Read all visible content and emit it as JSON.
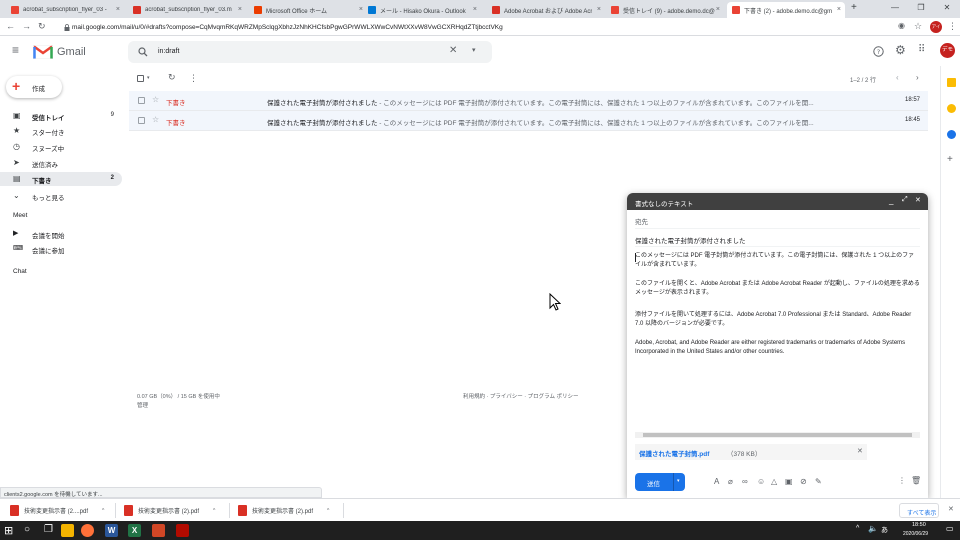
{
  "browser": {
    "tabs": [
      {
        "label": "acrobat_subscription_flyer_03 - ",
        "icon": "gmail-icon",
        "color": "#ea4335"
      },
      {
        "label": "acrobat_subscription_flyer_03.m",
        "icon": "acrobat-icon",
        "color": "#d93025"
      },
      {
        "label": "Microsoft Office ホーム",
        "icon": "office-icon",
        "color": "#eb3c00"
      },
      {
        "label": "メール - Hisako Okura - Outlook",
        "icon": "outlook-icon",
        "color": "#0078d4"
      },
      {
        "label": "Adobe Acrobat および Adobe Acr",
        "icon": "adobe-icon",
        "color": "#d93025"
      },
      {
        "label": "受信トレイ (9) - adobe.demo.dc@",
        "icon": "gmail-icon",
        "color": "#ea4335"
      },
      {
        "label": "下書き (2) - adobe.demo.dc@gm",
        "icon": "gmail-icon",
        "color": "#ea4335"
      }
    ],
    "new_tab": "+",
    "url": "mail.google.com/mail/u/0/#drafts?compose=CqMvqmRKqWRZMpSclqgXbhzJzNhKHCfsbPgwGPrWWLXWwCvNWtXXvW8VwGCXRHqdZTtjbcctVKg",
    "profile_initials": "アイ"
  },
  "gmail": {
    "logo_text": "Gmail",
    "search_value": "in:draft",
    "avatar_text": "デモ",
    "compose_label": "作成",
    "sidebar": {
      "items": [
        {
          "label": "受信トレイ",
          "count": "9",
          "icon": "inbox-icon",
          "bold": true
        },
        {
          "label": "スター付き",
          "count": "",
          "icon": "star-icon"
        },
        {
          "label": "スヌーズ中",
          "count": "",
          "icon": "clock-icon"
        },
        {
          "label": "送信済み",
          "count": "",
          "icon": "send-icon"
        },
        {
          "label": "下書き",
          "count": "2",
          "icon": "draft-icon",
          "active": true
        },
        {
          "label": "もっと見る",
          "count": "",
          "icon": "chevron-down-icon"
        }
      ],
      "meet_heading": "Meet",
      "meet_items": [
        {
          "label": "会議を開始",
          "icon": "video-icon"
        },
        {
          "label": "会議に参加",
          "icon": "keyboard-icon"
        }
      ],
      "chat_heading": "Chat"
    },
    "toolbar": {
      "pagination": "1–2 / 2 行"
    },
    "rows": [
      {
        "sender": "下書き",
        "subject": "保護された電子封筒が添付されました",
        "snippet": " - このメッセージには PDF 電子封筒が添付されています。この電子封筒には、保護された 1 つ以上のファイルが含まれています。このファイルを開...",
        "time": "18:57"
      },
      {
        "sender": "下書き",
        "subject": "保護された電子封筒が添付されました",
        "snippet": " - このメッセージには PDF 電子封筒が添付されています。この電子封筒には、保護された 1 つ以上のファイルが含まれています。このファイルを開...",
        "time": "18:45"
      }
    ],
    "footer": {
      "storage": "0.07 GB（0%） / 15 GB を使用中",
      "manage": "管理",
      "links": "利用規約 · プライバシー · プログラム ポリシー"
    },
    "status_url": "clients2.google.com を待機しています..."
  },
  "compose": {
    "title": "書式なしのテキスト",
    "to_label": "宛先",
    "subject": "保護された電子封筒が添付されました",
    "body": [
      "このメッセージには PDF 電子封筒が添付されています。この電子封筒には、保護された 1 つ以上のファイルが含まれています。",
      "このファイルを開くと、Adobe Acrobat または Adobe Acrobat Reader が起動し、ファイルの処理を求めるメッセージが表示されます。",
      "添付ファイルを開いて処理するには、Adobe Acrobat 7.0 Professional または Standard、Adobe Reader 7.0 以降のバージョンが必要です。",
      "Adobe, Acrobat, and Adobe Reader are either registered trademarks or trademarks of Adobe Systems Incorporated in the United States and/or other countries."
    ],
    "attachment_name": "保護された電子封筒.pdf",
    "attachment_size": "（378 KB）",
    "send_label": "送信"
  },
  "downloads": {
    "items": [
      "技術変更指示書 (2....pdf",
      "技術変更指示書 (2).pdf",
      "技術変更指示書 (2).pdf"
    ],
    "show_all": "すべて表示"
  },
  "taskbar": {
    "time": "18:50",
    "date": "2020/06/29",
    "ime": "あ"
  }
}
